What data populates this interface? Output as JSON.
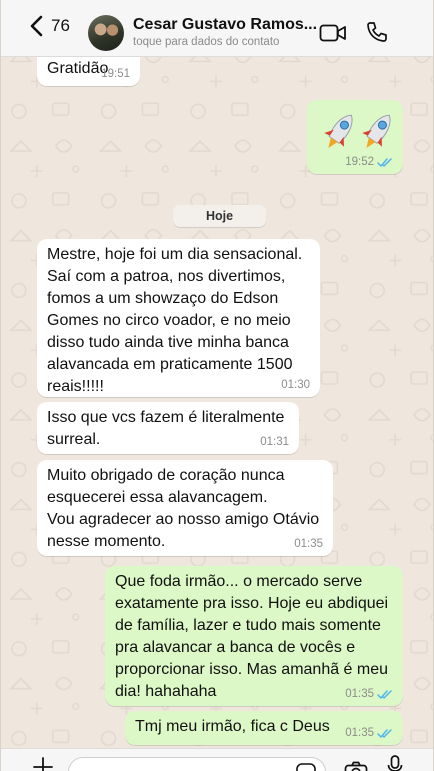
{
  "header": {
    "back_count": "76",
    "contact_name": "Cesar Gustavo Ramos...",
    "contact_subtitle": "toque para dados do contato"
  },
  "date_divider": "Hoje",
  "messages": [
    {
      "direction": "in",
      "text": "Gratidão",
      "time": "19:51"
    },
    {
      "direction": "out",
      "content": "sticker",
      "sticker_icon": "rocket-emoji-icon",
      "time": "19:52",
      "status": "read"
    },
    {
      "direction": "in",
      "text": "Mestre, hoje foi um dia sensacional. Saí com a patroa, nos divertimos, fomos a um showzaço do Edson Gomes no circo voador, e no meio disso tudo ainda tive minha banca alavancada em praticamente 1500 reais!!!!!",
      "time": "01:30"
    },
    {
      "direction": "in",
      "text": "Isso que vcs fazem é literalmente surreal.",
      "time": "01:31"
    },
    {
      "direction": "in",
      "text": "Muito obrigado de coração nunca esquecerei essa alavancagem.\nVou agradecer ao nosso amigo Otávio nesse momento.",
      "time": "01:35"
    },
    {
      "direction": "out",
      "text": "Que foda irmão... o mercado serve exatamente pra isso. Hoje eu abdiquei de família, lazer e tudo mais somente pra alavancar a banca de vocês e proporcionar isso. Mas amanhã é meu dia! hahahaha",
      "time": "01:35",
      "status": "read"
    },
    {
      "direction": "out",
      "text": "Tmj meu irmão, fica c Deus",
      "time": "01:35",
      "status": "read"
    }
  ],
  "colors": {
    "incoming_bubble": "#ffffff",
    "outgoing_bubble": "#dcf8c6",
    "read_ticks": "#4fb6ec",
    "wallpaper": "#efe7de"
  }
}
